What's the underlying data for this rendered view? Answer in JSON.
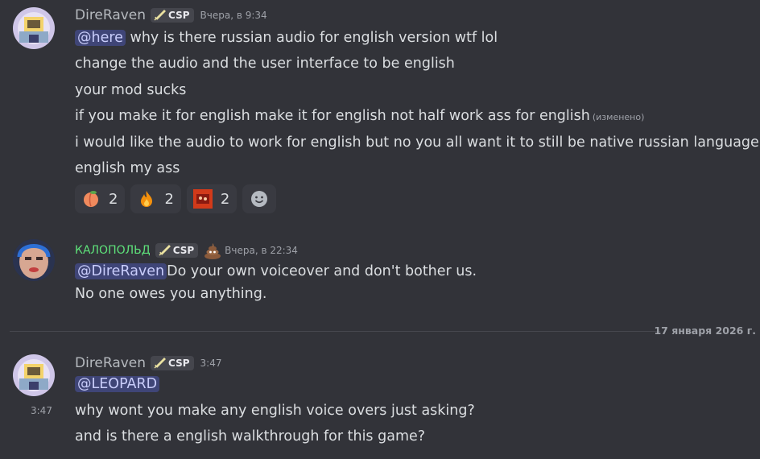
{
  "messages": [
    {
      "username": "DireRaven",
      "tag": "CSP",
      "timestamp": "Вчера, в 9:34",
      "mention": "@here",
      "lines": [
        " why is there russian audio for english version wtf lol",
        "change the audio and the user interface to be english",
        "your mod sucks",
        "if you make it for english make it for english not half work ass for english",
        "i would like the audio to work for english but no you all want it to still be native russian language",
        "english my ass"
      ],
      "edited_label": "(изменено)",
      "reactions": [
        {
          "emoji": "peach-icon",
          "count": "2"
        },
        {
          "emoji": "fire-icon",
          "count": "2"
        },
        {
          "emoji": "custom-sticker-icon",
          "count": "2"
        }
      ]
    },
    {
      "username": "КАЛОПОЛЬД",
      "tag": "CSP",
      "timestamp": "Вчера, в 22:34",
      "mention": "@DireRaven",
      "lines": [
        "Do your own voiceover and don't bother us.",
        "No one owes you anything."
      ]
    },
    {
      "username": "DireRaven",
      "tag": "CSP",
      "timestamp": "3:47",
      "side_time": "3:47",
      "mention": "@LEOPARD",
      "lines": [
        "why wont you  make  any english voice overs just asking?",
        "and is there a english walkthrough for this game?"
      ]
    }
  ],
  "divider": {
    "date": "17 января 2026 г."
  },
  "colors": {
    "background": "#323339",
    "mention_bg": "#3f4577",
    "mention_text": "#c9cdfb",
    "username_green": "#5ee27a"
  }
}
